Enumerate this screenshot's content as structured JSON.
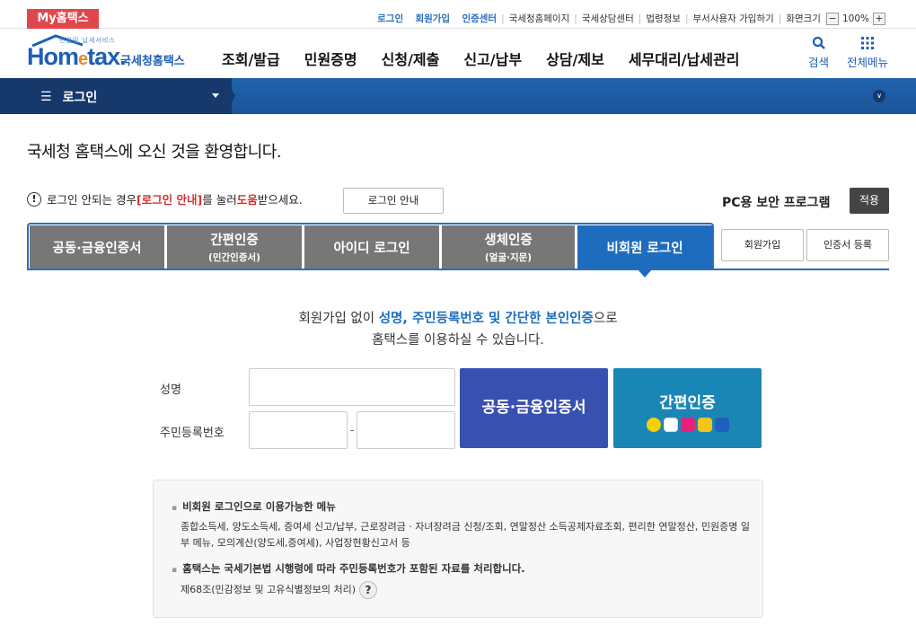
{
  "topbar": {
    "my_hometax": "My홈택스",
    "links_blue": [
      "로그인",
      "회원가입",
      "인증센터"
    ],
    "links": [
      "국세청홈페이지",
      "국세상담센터",
      "법령정보",
      "부서사용자 가입하기"
    ],
    "screen_size_label": "화면크기",
    "zoom_minus": "−",
    "zoom_value": "100%",
    "zoom_plus": "+"
  },
  "logo": {
    "small_text": "민원및 납세서비스",
    "main_prefix": "Hom",
    "main_e": "e",
    "main_suffix": "tax.",
    "korean": "국세청홈택스"
  },
  "gnb": [
    "조회/발급",
    "민원증명",
    "신청/제출",
    "신고/납부",
    "상담/제보",
    "세무대리/납세관리"
  ],
  "header_buttons": {
    "search": "검색",
    "all_menu": "전체메뉴"
  },
  "location": {
    "current": "로그인"
  },
  "welcome": "국세청 홈택스에 오신 것을 환영합니다.",
  "notice": {
    "text_before": "로그인 안되는 경우 ",
    "red_link": "[로그인 안내]",
    "text_mid": "를 눌러 ",
    "red_word": "도움",
    "text_after": "받으세요.",
    "guide_button": "로그인 안내"
  },
  "security": {
    "label": "PC용 보안 프로그램",
    "apply": "적용"
  },
  "tabs": [
    {
      "main": "공동·금융인증서",
      "sub": ""
    },
    {
      "main": "간편인증",
      "sub": "(민간인증서)"
    },
    {
      "main": "아이디 로그인",
      "sub": ""
    },
    {
      "main": "생체인증",
      "sub": "(얼굴·지문)"
    },
    {
      "main": "비회원 로그인",
      "sub": ""
    }
  ],
  "side_buttons": {
    "join": "회원가입",
    "cert_register": "인증서 등록"
  },
  "intro": {
    "line1_before": "회원가입 없이 ",
    "line1_highlight": "성명, 주민등록번호 및 간단한 본인인증",
    "line1_after": "으로",
    "line2": "홈택스를 이용하실 수 있습니다."
  },
  "form": {
    "name_label": "성명",
    "rrn_label": "주민등록번호",
    "name_value": "",
    "rrn_front": "",
    "rrn_back": "",
    "dash": "-",
    "cert_button": "공동·금융인증서",
    "simple_button": "간편인증",
    "simple_icons": [
      "kakao",
      "toss",
      "PASS",
      "payco",
      "samsung"
    ]
  },
  "info": {
    "title1": "비회원 로그인으로 이용가능한 메뉴",
    "body1": "종합소득세, 양도소득세, 증여세 신고/납부, 근로장려금 · 자녀장려금 신청/조회, 연말정산 소득공제자료조회, 편리한 연말정산, 민원증명 일부 메뉴, 모의계산(양도세,증여세), 사업장현황신고서 등",
    "title2": "홈택스는 국세기본법 시행령에 따라 주민등록번호가 포함된 자료를 처리합니다.",
    "body2": "제68조(민감정보 및 고유식별정보의 처리)",
    "help": "?"
  }
}
